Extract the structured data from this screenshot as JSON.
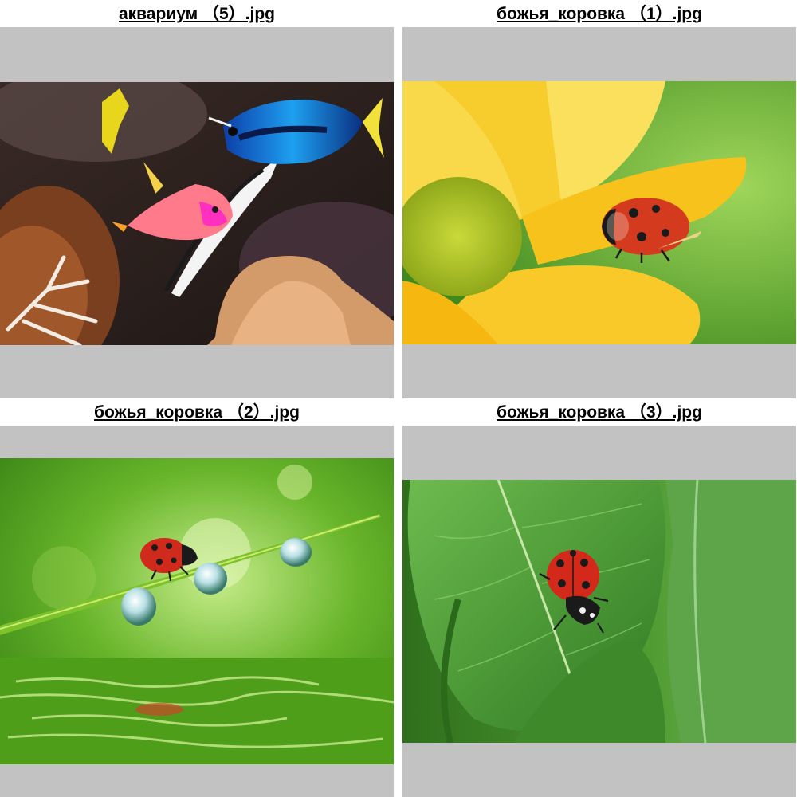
{
  "gallery": {
    "items": [
      {
        "caption": "аквариум （5）.jpg",
        "subject": "aquarium-fish",
        "colors": {
          "bg": "#2a1f1c",
          "accent": "#1e88e5"
        }
      },
      {
        "caption": "божья_коровка （1）.jpg",
        "subject": "ladybug-on-yellow-flower",
        "colors": {
          "bg": "#79b93a",
          "accent": "#f6c21b"
        }
      },
      {
        "caption": "божья_коровка （2）.jpg",
        "subject": "ladybug-on-grass-with-dew",
        "colors": {
          "bg": "#5aa521",
          "accent": "#c62828"
        }
      },
      {
        "caption": "божья_коровка （3）.jpg",
        "subject": "ladybug-on-green-leaf",
        "colors": {
          "bg": "#3f8f2e",
          "accent": "#d32f2f"
        }
      }
    ],
    "frame_color": "#c2c2c2"
  }
}
